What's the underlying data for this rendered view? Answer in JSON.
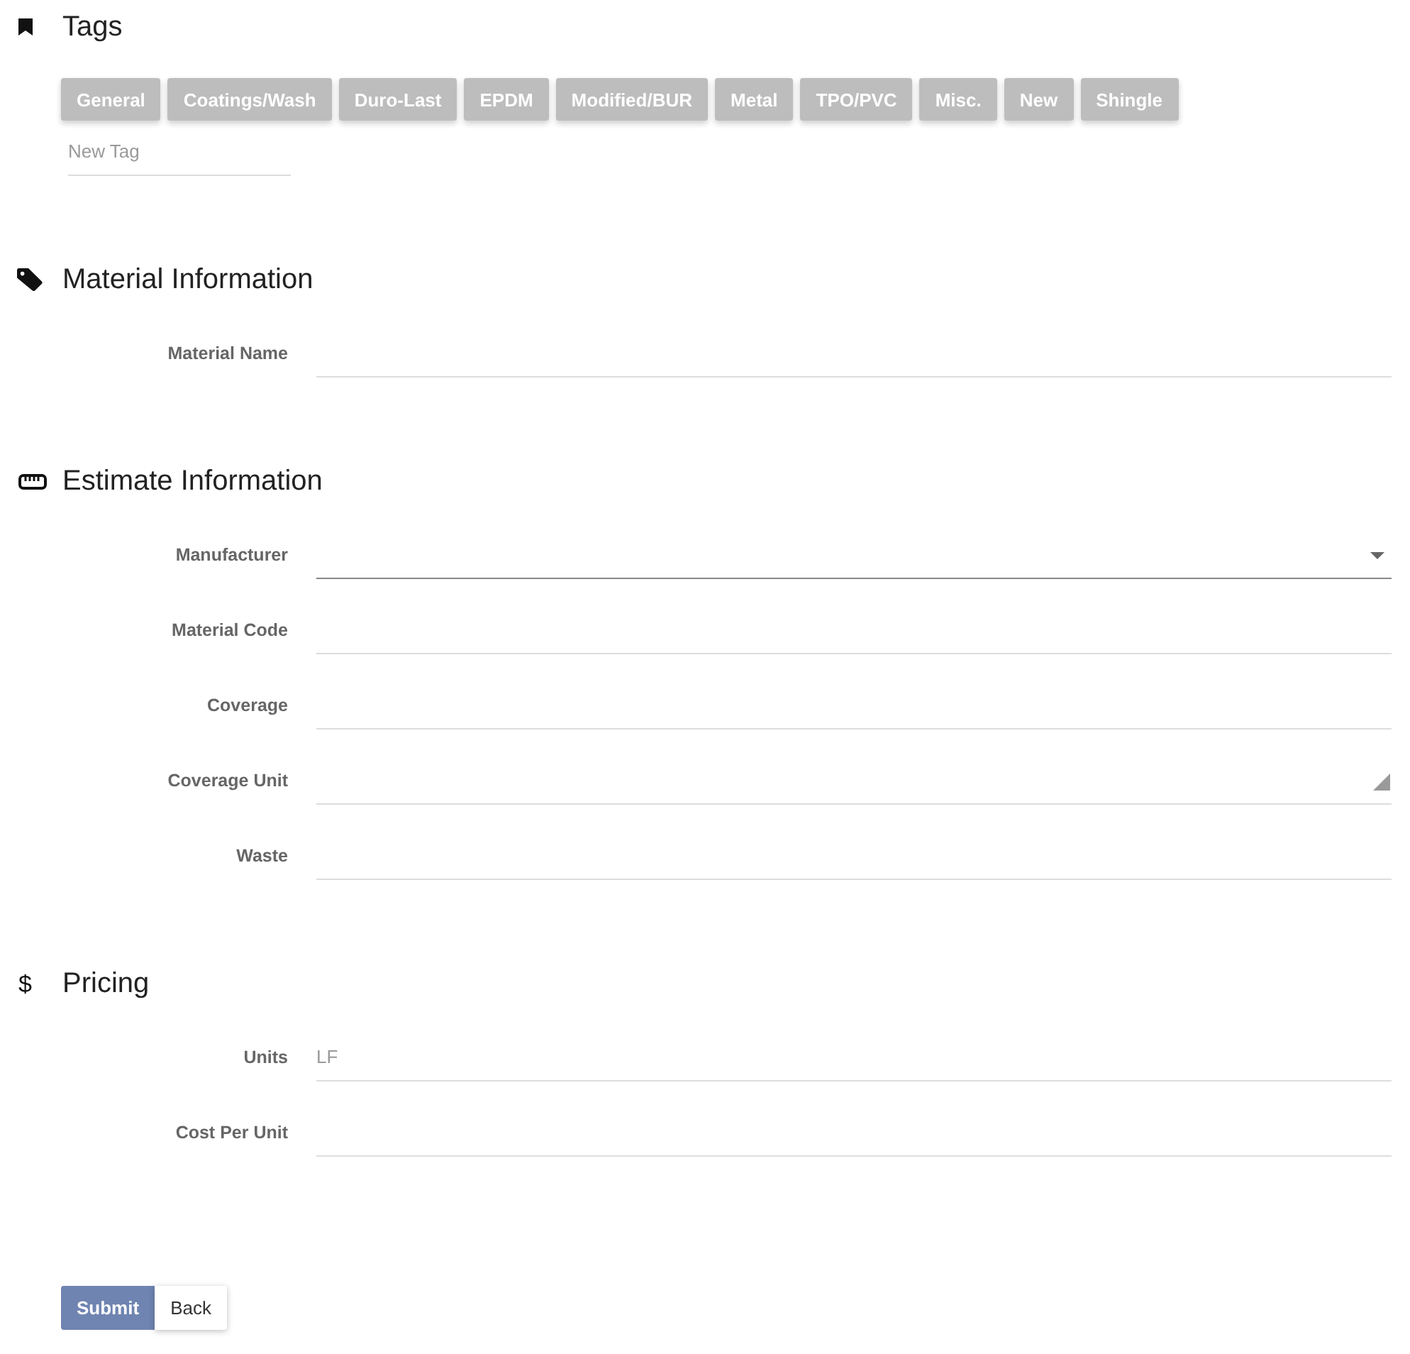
{
  "tags": {
    "title": "Tags",
    "items": [
      "General",
      "Coatings/Wash",
      "Duro-Last",
      "EPDM",
      "Modified/BUR",
      "Metal",
      "TPO/PVC",
      "Misc.",
      "New",
      "Shingle"
    ],
    "new_tag": {
      "placeholder": "New Tag"
    }
  },
  "material_information": {
    "title": "Material Information",
    "fields": [
      {
        "label": "Material Name",
        "kind": "text"
      }
    ]
  },
  "estimate_information": {
    "title": "Estimate Information",
    "fields": [
      {
        "label": "Manufacturer",
        "kind": "select"
      },
      {
        "label": "Material Code",
        "kind": "text"
      },
      {
        "label": "Coverage",
        "kind": "text"
      },
      {
        "label": "Coverage Unit",
        "kind": "textarea"
      },
      {
        "label": "Waste",
        "kind": "text"
      }
    ]
  },
  "pricing": {
    "icon": "$",
    "title": "Pricing",
    "fields": [
      {
        "label": "Units",
        "kind": "text",
        "placeholder": "LF"
      },
      {
        "label": "Cost Per Unit",
        "kind": "text"
      }
    ]
  },
  "buttons": [
    {
      "label": "Submit",
      "kind": "primary"
    },
    {
      "label": "Back",
      "kind": "secondary"
    }
  ]
}
